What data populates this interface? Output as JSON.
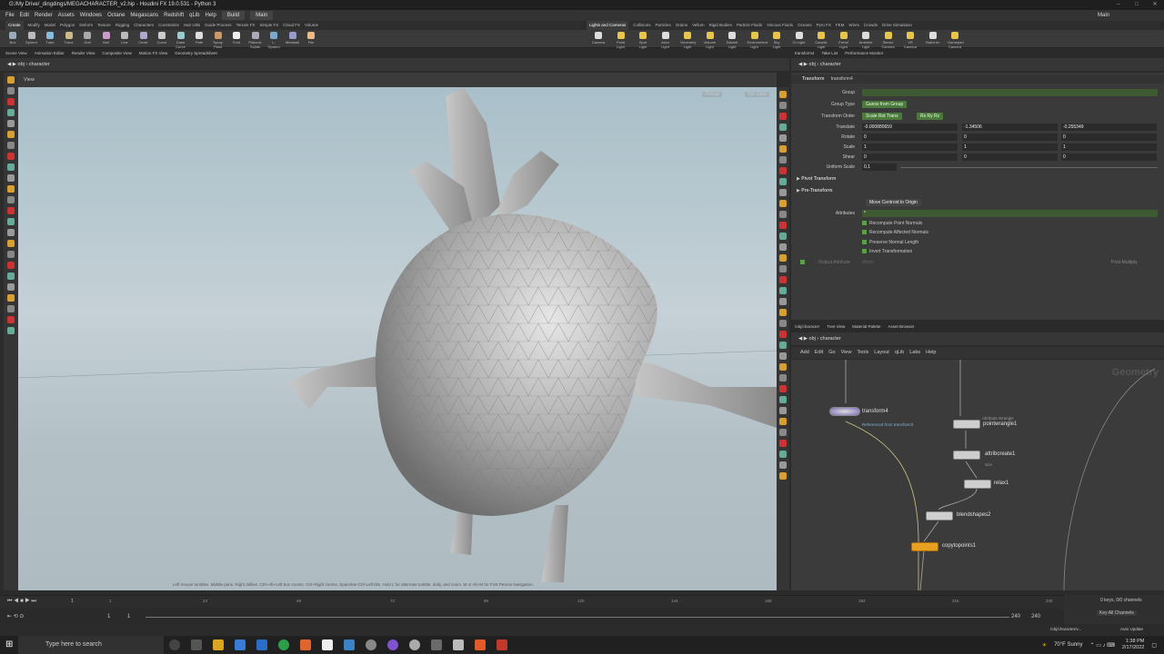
{
  "title": "G:/My Drive/_dingdings/MEGACHARACTER_v2.hip - Houdini FX 19.0.531 - Python 3",
  "menu": [
    "File",
    "Edit",
    "Render",
    "Assets",
    "Windows",
    "Octane",
    "Megascans",
    "Redshift",
    "qLib",
    "Help"
  ],
  "desktop_build": "Build",
  "desktop_main": "Main",
  "main_right": "Main",
  "shelf_tabs_left": [
    "Create",
    "Modify",
    "Model",
    "Polygon",
    "Deform",
    "Texture",
    "Rigging",
    "Characters",
    "Constraints",
    "Hair Utils",
    "Guide Process",
    "Terrain FX",
    "Simple FX",
    "Cloud FX",
    "Volume"
  ],
  "shelf_tabs_right": [
    "Lights and Cameras",
    "Collisions",
    "Particles",
    "Grains",
    "Vellum",
    "Rigid Bodies",
    "Particle Fluids",
    "Viscous Fluids",
    "Oceans",
    "Pyro FX",
    "FEM",
    "Wires",
    "Crowds",
    "Drive Simulation"
  ],
  "shelf_tools_left": [
    "Box",
    "Sphere",
    "Tube",
    "Torus",
    "Grid",
    "Null",
    "Line",
    "Circle",
    "Curve",
    "Draw Curve",
    "Path",
    "Spray Paint",
    "Font",
    "Platonic Solids",
    "L-System",
    "Metaball",
    "File"
  ],
  "shelf_tools_right": [
    "Camera",
    "Point Light",
    "Spot Light",
    "Area Light",
    "Geometry Light",
    "Volume Light",
    "Distant Light",
    "Environment Light",
    "Sky Light",
    "GI Light",
    "Caustic Light",
    "Portal Light",
    "Ambient Light",
    "Stereo Camera",
    "VR Camera",
    "Switcher",
    "Gamepad Camera"
  ],
  "viewer_tabs": [
    "Scene View",
    "Animation Editor",
    "Render View",
    "Composite View",
    "Motion FX View",
    "Geometry Spreadsheet"
  ],
  "viewer_path": {
    "obj": "obj",
    "node": "character"
  },
  "view_label": "View",
  "persp": "Persp",
  "nocam": "No cam",
  "help_text": "Left mouse tumbles. Middle pans. Right dollies. Ctrl+Alt+Left box zooms. Ctrl+Right zooms. Spacebar-Ctrl-Left tilts. Hold L for alternate tumble, dolly, and zoom.    M or Alt+M for First Person Navigation.",
  "timeline": {
    "ticks": [
      "1",
      "24",
      "48",
      "72",
      "96",
      "120",
      "144",
      "168",
      "192",
      "216",
      "240"
    ],
    "frame": "1",
    "start": "1",
    "start2": "1",
    "end": "240",
    "end2": "240"
  },
  "keys": {
    "channels": "0 keys, 0/0 channels",
    "key_all": "Key All Channels",
    "auto_update": "Auto Update",
    "path": "/obj/character/v..."
  },
  "param_tabs": [
    "transform4",
    "Take List",
    "Performance Monitor"
  ],
  "param_path": {
    "obj": "obj",
    "node": "character"
  },
  "transform": {
    "type": "Transform",
    "name": "transform4",
    "group_label": "Group",
    "group_type_label": "Group Type",
    "group_type": "Guess from Group",
    "order_label": "Transform Order",
    "order1": "Scale Rot Trans",
    "order2": "Rx Ry Rz",
    "translate_label": "Translate",
    "translate": [
      "-0.000880659",
      "-1.34506",
      "-0.255349"
    ],
    "rotate_label": "Rotate",
    "rotate": [
      "0",
      "0",
      "0"
    ],
    "scale_label": "Scale",
    "scale": [
      "1",
      "1",
      "1"
    ],
    "shear_label": "Shear",
    "shear": [
      "0",
      "0",
      "0"
    ],
    "uniform_label": "Uniform Scale",
    "uniform": "0.1",
    "pivot": "Pivot Transform",
    "pretransform": "Pre-Transform",
    "move_centroid": "Move Centroid to Origin",
    "attributes_label": "Attributes",
    "attributes": "*",
    "checks": [
      "Recompute Point Normals",
      "Recompute Affected Normals",
      "Preserve Normal Length",
      "Invert Transformation"
    ],
    "output_attrib_label": "Output Attribute",
    "output_attrib": "xform",
    "post_multiply": "Post-Multiply"
  },
  "network_tabs": [
    "/obj/character",
    "Tree View",
    "Material Palette",
    "Asset Browser"
  ],
  "network_path": {
    "obj": "obj",
    "node": "character"
  },
  "network_menu": [
    "Add",
    "Edit",
    "Go",
    "View",
    "Tools",
    "Layout",
    "qLib",
    "Labs",
    "Help"
  ],
  "network_title": "Geometry",
  "nodes": {
    "transform4": "transform4",
    "transform4_sub": "Referenced from transform3",
    "pointwrangle1": "pointwrangle1",
    "pointwrangle1_sub": "Attribute Wrangle",
    "attribcreate1": "attribcreate1",
    "attribcreate1_sub": "size",
    "relax1": "relax1",
    "blendshapes2": "blendshapes2",
    "copytopoints1": "copytopoints1"
  },
  "taskbar": {
    "search": "Type here to search",
    "weather": "70°F  Sunny",
    "time": "1:38 PM",
    "date": "2/17/2022"
  },
  "colors": {
    "accent_green": "#4c7a3c",
    "copy_node": "#e8a020",
    "viewport_sky": "#b8c8cf"
  }
}
